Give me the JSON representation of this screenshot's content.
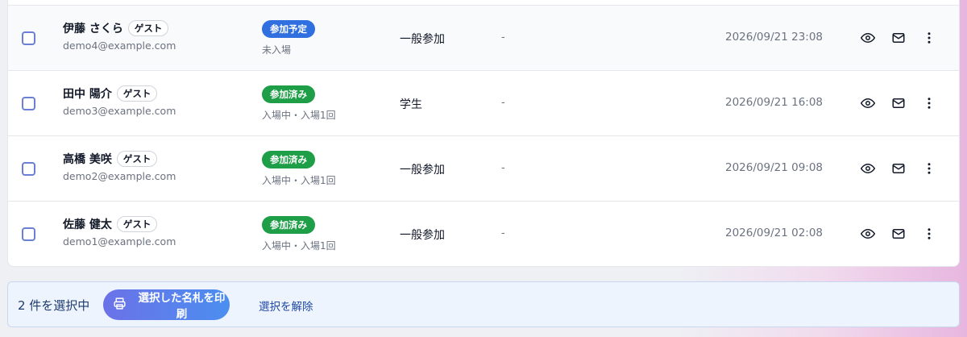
{
  "attendees": [
    {
      "name": "伊藤 さくら",
      "tag": "ゲスト",
      "email": "demo4@example.com",
      "status": "参加予定",
      "status_color": "#2f6fe0",
      "sub_status": "未入場",
      "category": "一般参加",
      "note": "-",
      "datetime": "2026/09/21 23:08"
    },
    {
      "name": "田中 陽介",
      "tag": "ゲスト",
      "email": "demo3@example.com",
      "status": "参加済み",
      "status_color": "#1e9e47",
      "sub_status": "入場中・入場1回",
      "category": "学生",
      "note": "-",
      "datetime": "2026/09/21 16:08"
    },
    {
      "name": "高橋 美咲",
      "tag": "ゲスト",
      "email": "demo2@example.com",
      "status": "参加済み",
      "status_color": "#1e9e47",
      "sub_status": "入場中・入場1回",
      "category": "一般参加",
      "note": "-",
      "datetime": "2026/09/21 09:08"
    },
    {
      "name": "佐藤 健太",
      "tag": "ゲスト",
      "email": "demo1@example.com",
      "status": "参加済み",
      "status_color": "#1e9e47",
      "sub_status": "入場中・入場1回",
      "category": "一般参加",
      "note": "-",
      "datetime": "2026/09/21 02:08"
    }
  ],
  "row_icons": [
    "eye-icon",
    "mail-icon",
    "more-vertical-icon"
  ],
  "selection_bar": {
    "count_text": "2 件を選択中",
    "print_label": "選択した名札を印刷",
    "print_icon": "printer-icon",
    "clear_label": "選択を解除"
  }
}
